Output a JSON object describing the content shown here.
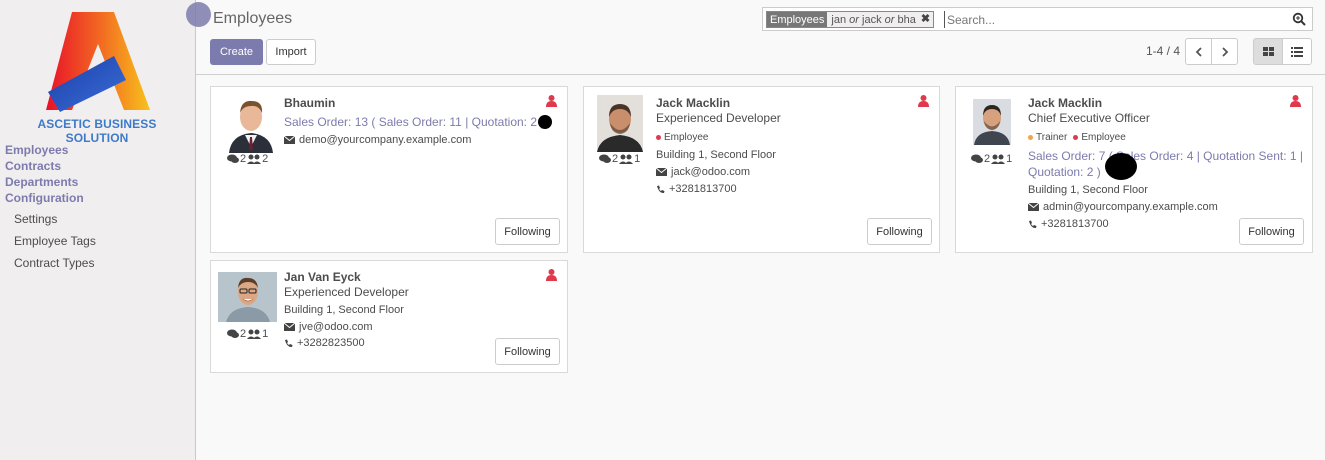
{
  "sidebar": {
    "company_name": "ASCETIC BUSINESS SOLUTION",
    "sections": [
      {
        "label": "Employees"
      },
      {
        "label": "Contracts"
      },
      {
        "label": "Departments"
      },
      {
        "label": "Configuration"
      }
    ],
    "config_items": [
      {
        "label": "Settings"
      },
      {
        "label": "Employee Tags"
      },
      {
        "label": "Contract Types"
      }
    ]
  },
  "control": {
    "breadcrumb": "Employees",
    "create_label": "Create",
    "import_label": "Import",
    "pager": "1-4 / 4"
  },
  "search": {
    "facet_category": "Employees",
    "facet_parts": [
      "jan",
      "or",
      "jack",
      "or",
      "bha"
    ],
    "placeholder": "Search..."
  },
  "colors": {
    "accent": "#7c7bad",
    "user_icon": "#e0394e",
    "trainer_tag": "#f0a24d",
    "employee_tag": "#e0394e"
  },
  "employees": [
    {
      "name": "Bhaumin",
      "job": "",
      "sales_link": "Sales Order: 13 ( Sales Order: 11 | Quotation: 2 )",
      "tags": [],
      "location": "",
      "email": "demo@yourcompany.example.com",
      "phone": "",
      "messages": "2",
      "followers": "2",
      "follow_label": "Following"
    },
    {
      "name": "Jack Macklin",
      "job": "Experienced Developer",
      "sales_link": "",
      "tags": [
        "Employee"
      ],
      "location": "Building 1, Second Floor",
      "email": "jack@odoo.com",
      "phone": "+3281813700",
      "messages": "2",
      "followers": "1",
      "follow_label": "Following"
    },
    {
      "name": "Jack Macklin",
      "job": "Chief Executive Officer",
      "sales_link_line1": "Sales Order: 7 ( Sales Order: 4 | Quotation Sent: 1 |",
      "sales_link_line2": "Quotation: 2 )",
      "tags": [
        "Trainer",
        "Employee"
      ],
      "location": "Building 1, Second Floor",
      "email": "admin@yourcompany.example.com",
      "phone": "+3281813700",
      "messages": "2",
      "followers": "1",
      "follow_label": "Following"
    },
    {
      "name": "Jan Van Eyck",
      "job": "Experienced Developer",
      "sales_link": "",
      "tags": [],
      "location": "Building 1, Second Floor",
      "email": "jve@odoo.com",
      "phone": "+3282823500",
      "messages": "2",
      "followers": "1",
      "follow_label": "Following"
    }
  ]
}
